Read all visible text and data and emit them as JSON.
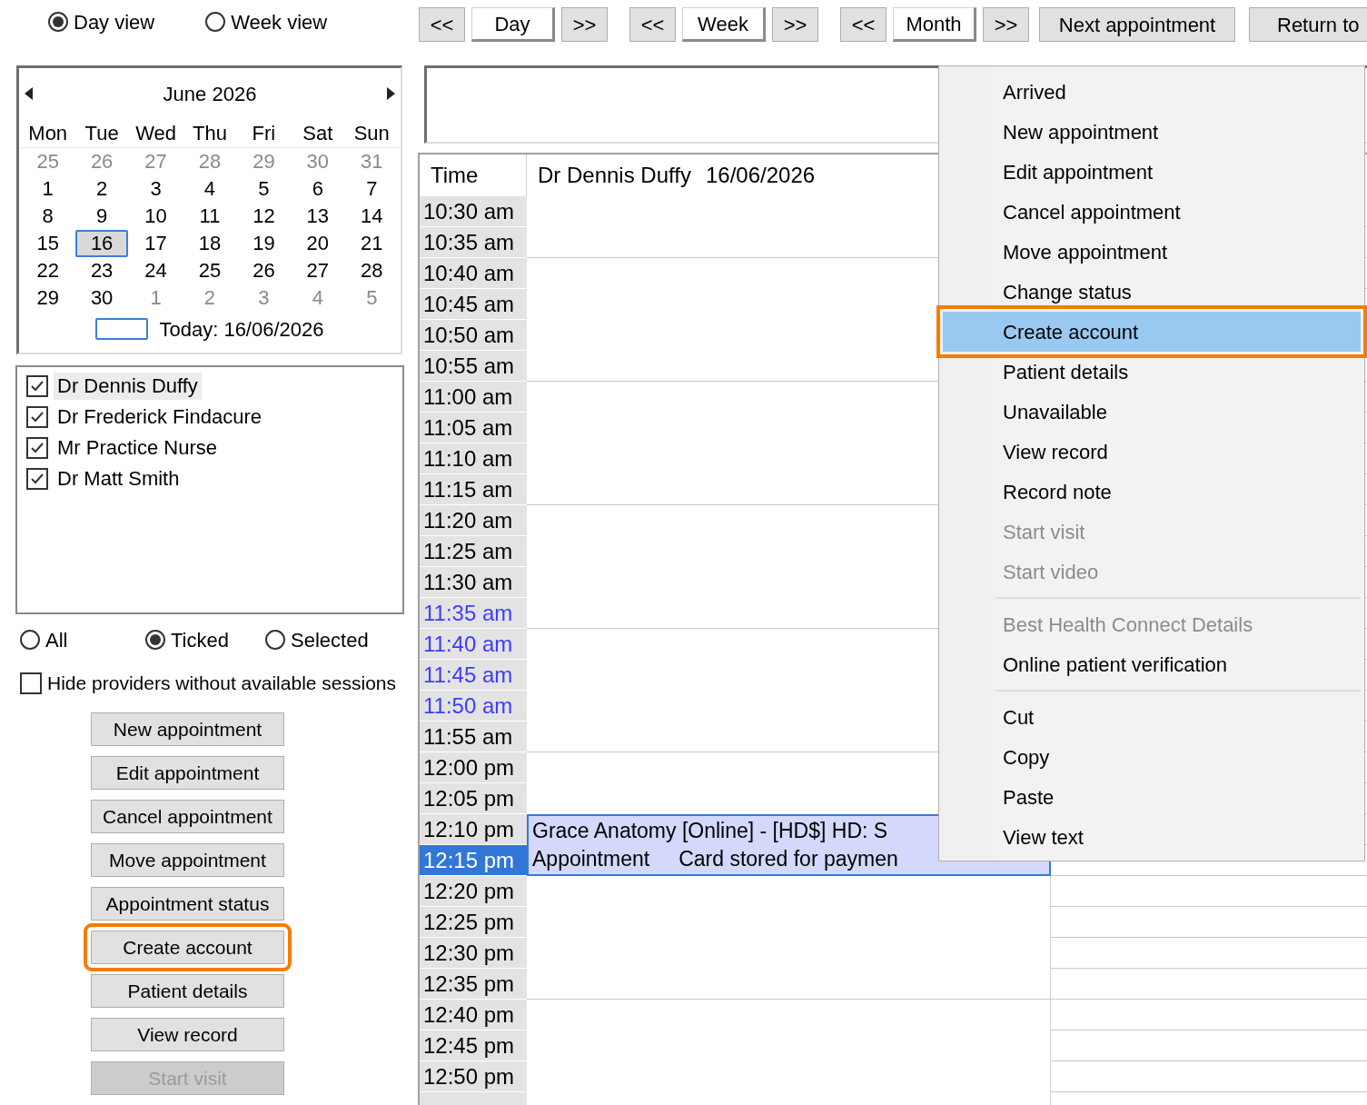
{
  "view_options": [
    {
      "label": "Day view",
      "selected": true
    },
    {
      "label": "Week view",
      "selected": false
    }
  ],
  "nav_groups": [
    [
      {
        "label": "<<",
        "kind": "step"
      },
      {
        "label": "Day",
        "kind": "period"
      },
      {
        "label": ">>",
        "kind": "step"
      }
    ],
    [
      {
        "label": "<<",
        "kind": "step"
      },
      {
        "label": "Week",
        "kind": "period"
      },
      {
        "label": ">>",
        "kind": "step"
      }
    ],
    [
      {
        "label": "<<",
        "kind": "step"
      },
      {
        "label": "Month",
        "kind": "period"
      },
      {
        "label": ">>",
        "kind": "step"
      }
    ]
  ],
  "nav_buttons": [
    "Next appointment",
    "Return to"
  ],
  "calendar": {
    "month": "June 2026",
    "weekdays": [
      "Mon",
      "Tue",
      "Wed",
      "Thu",
      "Fri",
      "Sat",
      "Sun"
    ],
    "weeks": [
      [
        {
          "day": "25",
          "outside": true,
          "selected": false
        },
        {
          "day": "26",
          "outside": true,
          "selected": false
        },
        {
          "day": "27",
          "outside": true,
          "selected": false
        },
        {
          "day": "28",
          "outside": true,
          "selected": false
        },
        {
          "day": "29",
          "outside": true,
          "selected": false
        },
        {
          "day": "30",
          "outside": true,
          "selected": false
        },
        {
          "day": "31",
          "outside": true,
          "selected": false
        }
      ],
      [
        {
          "day": "1",
          "outside": false,
          "selected": false
        },
        {
          "day": "2",
          "outside": false,
          "selected": false
        },
        {
          "day": "3",
          "outside": false,
          "selected": false
        },
        {
          "day": "4",
          "outside": false,
          "selected": false
        },
        {
          "day": "5",
          "outside": false,
          "selected": false
        },
        {
          "day": "6",
          "outside": false,
          "selected": false
        },
        {
          "day": "7",
          "outside": false,
          "selected": false
        }
      ],
      [
        {
          "day": "8",
          "outside": false,
          "selected": false
        },
        {
          "day": "9",
          "outside": false,
          "selected": false
        },
        {
          "day": "10",
          "outside": false,
          "selected": false
        },
        {
          "day": "11",
          "outside": false,
          "selected": false
        },
        {
          "day": "12",
          "outside": false,
          "selected": false
        },
        {
          "day": "13",
          "outside": false,
          "selected": false
        },
        {
          "day": "14",
          "outside": false,
          "selected": false
        }
      ],
      [
        {
          "day": "15",
          "outside": false,
          "selected": false
        },
        {
          "day": "16",
          "outside": false,
          "selected": true
        },
        {
          "day": "17",
          "outside": false,
          "selected": false
        },
        {
          "day": "18",
          "outside": false,
          "selected": false
        },
        {
          "day": "19",
          "outside": false,
          "selected": false
        },
        {
          "day": "20",
          "outside": false,
          "selected": false
        },
        {
          "day": "21",
          "outside": false,
          "selected": false
        }
      ],
      [
        {
          "day": "22",
          "outside": false,
          "selected": false
        },
        {
          "day": "23",
          "outside": false,
          "selected": false
        },
        {
          "day": "24",
          "outside": false,
          "selected": false
        },
        {
          "day": "25",
          "outside": false,
          "selected": false
        },
        {
          "day": "26",
          "outside": false,
          "selected": false
        },
        {
          "day": "27",
          "outside": false,
          "selected": false
        },
        {
          "day": "28",
          "outside": false,
          "selected": false
        }
      ],
      [
        {
          "day": "29",
          "outside": false,
          "selected": false
        },
        {
          "day": "30",
          "outside": false,
          "selected": false
        },
        {
          "day": "1",
          "outside": true,
          "selected": false
        },
        {
          "day": "2",
          "outside": true,
          "selected": false
        },
        {
          "day": "3",
          "outside": true,
          "selected": false
        },
        {
          "day": "4",
          "outside": true,
          "selected": false
        },
        {
          "day": "5",
          "outside": true,
          "selected": false
        }
      ]
    ],
    "today": "Today: 16/06/2026"
  },
  "providers": [
    {
      "name": "Dr Dennis Duffy",
      "checked": true,
      "selected": true
    },
    {
      "name": "Dr Frederick Findacure",
      "checked": true,
      "selected": false
    },
    {
      "name": "Mr Practice Nurse",
      "checked": true,
      "selected": false
    },
    {
      "name": "Dr Matt Smith",
      "checked": true,
      "selected": false
    }
  ],
  "filters": [
    {
      "label": "All",
      "selected": false
    },
    {
      "label": "Ticked",
      "selected": true
    },
    {
      "label": "Selected",
      "selected": false
    }
  ],
  "hide_providers": {
    "label": "Hide providers without available sessions",
    "checked": false
  },
  "actions": [
    {
      "label": "New appointment",
      "disabled": false,
      "callout": false
    },
    {
      "label": "Edit appointment",
      "disabled": false,
      "callout": false
    },
    {
      "label": "Cancel appointment",
      "disabled": false,
      "callout": false
    },
    {
      "label": "Move appointment",
      "disabled": false,
      "callout": false
    },
    {
      "label": "Appointment status",
      "disabled": false,
      "callout": false
    },
    {
      "label": "Create account",
      "disabled": false,
      "callout": true
    },
    {
      "label": "Patient details",
      "disabled": false,
      "callout": false
    },
    {
      "label": "View record",
      "disabled": false,
      "callout": false
    },
    {
      "label": "Start visit",
      "disabled": true,
      "callout": false
    }
  ],
  "schedule": {
    "time_header": "Time",
    "provider": "Dr Dennis Duffy",
    "date": "16/06/2026",
    "slots": [
      {
        "time": "10:30 am",
        "highlighted": false,
        "selected": false
      },
      {
        "time": "10:35 am",
        "highlighted": false,
        "selected": false
      },
      {
        "time": "10:40 am",
        "highlighted": false,
        "selected": false
      },
      {
        "time": "10:45 am",
        "highlighted": false,
        "selected": false
      },
      {
        "time": "10:50 am",
        "highlighted": false,
        "selected": false
      },
      {
        "time": "10:55 am",
        "highlighted": false,
        "selected": false
      },
      {
        "time": "11:00 am",
        "highlighted": false,
        "selected": false
      },
      {
        "time": "11:05 am",
        "highlighted": false,
        "selected": false
      },
      {
        "time": "11:10 am",
        "highlighted": false,
        "selected": false
      },
      {
        "time": "11:15 am",
        "highlighted": false,
        "selected": false
      },
      {
        "time": "11:20 am",
        "highlighted": false,
        "selected": false
      },
      {
        "time": "11:25 am",
        "highlighted": false,
        "selected": false
      },
      {
        "time": "11:30 am",
        "highlighted": false,
        "selected": false
      },
      {
        "time": "11:35 am",
        "highlighted": true,
        "selected": false
      },
      {
        "time": "11:40 am",
        "highlighted": true,
        "selected": false
      },
      {
        "time": "11:45 am",
        "highlighted": true,
        "selected": false
      },
      {
        "time": "11:50 am",
        "highlighted": true,
        "selected": false
      },
      {
        "time": "11:55 am",
        "highlighted": false,
        "selected": false
      },
      {
        "time": "12:00 pm",
        "highlighted": false,
        "selected": false
      },
      {
        "time": "12:05 pm",
        "highlighted": false,
        "selected": false
      },
      {
        "time": "12:10 pm",
        "highlighted": false,
        "selected": false,
        "appointment": {
          "lines": [
            [
              "Grace Anatomy [Online] - [HD$] HD: S"
            ],
            [
              "Appointment",
              "Card stored for paymen"
            ]
          ]
        }
      },
      {
        "time": "12:15 pm",
        "highlighted": false,
        "selected": true
      },
      {
        "time": "12:20 pm",
        "highlighted": false,
        "selected": false
      },
      {
        "time": "12:25 pm",
        "highlighted": false,
        "selected": false
      },
      {
        "time": "12:30 pm",
        "highlighted": false,
        "selected": false
      },
      {
        "time": "12:35 pm",
        "highlighted": false,
        "selected": false
      },
      {
        "time": "12:40 pm",
        "highlighted": false,
        "selected": false
      },
      {
        "time": "12:45 pm",
        "highlighted": false,
        "selected": false
      },
      {
        "time": "12:50 pm",
        "highlighted": false,
        "selected": false
      }
    ]
  },
  "context_menu": [
    {
      "kind": "item",
      "label": "Arrived",
      "disabled": false,
      "selected": false,
      "callout": false
    },
    {
      "kind": "item",
      "label": "New appointment",
      "disabled": false,
      "selected": false,
      "callout": false
    },
    {
      "kind": "item",
      "label": "Edit appointment",
      "disabled": false,
      "selected": false,
      "callout": false
    },
    {
      "kind": "item",
      "label": "Cancel appointment",
      "disabled": false,
      "selected": false,
      "callout": false
    },
    {
      "kind": "item",
      "label": "Move appointment",
      "disabled": false,
      "selected": false,
      "callout": false
    },
    {
      "kind": "item",
      "label": "Change status",
      "disabled": false,
      "selected": false,
      "callout": false
    },
    {
      "kind": "item",
      "label": "Create account",
      "disabled": false,
      "selected": true,
      "callout": true
    },
    {
      "kind": "item",
      "label": "Patient details",
      "disabled": false,
      "selected": false,
      "callout": false
    },
    {
      "kind": "item",
      "label": "Unavailable",
      "disabled": false,
      "selected": false,
      "callout": false
    },
    {
      "kind": "item",
      "label": "View record",
      "disabled": false,
      "selected": false,
      "callout": false
    },
    {
      "kind": "item",
      "label": "Record note",
      "disabled": false,
      "selected": false,
      "callout": false
    },
    {
      "kind": "item",
      "label": "Start visit",
      "disabled": true,
      "selected": false,
      "callout": false
    },
    {
      "kind": "item",
      "label": "Start video",
      "disabled": true,
      "selected": false,
      "callout": false
    },
    {
      "kind": "separator"
    },
    {
      "kind": "item",
      "label": "Best Health Connect Details",
      "disabled": true,
      "selected": false,
      "callout": false
    },
    {
      "kind": "item",
      "label": "Online patient verification",
      "disabled": false,
      "selected": false,
      "callout": false
    },
    {
      "kind": "separator"
    },
    {
      "kind": "item",
      "label": "Cut",
      "disabled": false,
      "selected": false,
      "callout": false
    },
    {
      "kind": "item",
      "label": "Copy",
      "disabled": false,
      "selected": false,
      "callout": false
    },
    {
      "kind": "item",
      "label": "Paste",
      "disabled": false,
      "selected": false,
      "callout": false
    },
    {
      "kind": "item",
      "label": "View text",
      "disabled": false,
      "selected": false,
      "callout": false
    }
  ]
}
